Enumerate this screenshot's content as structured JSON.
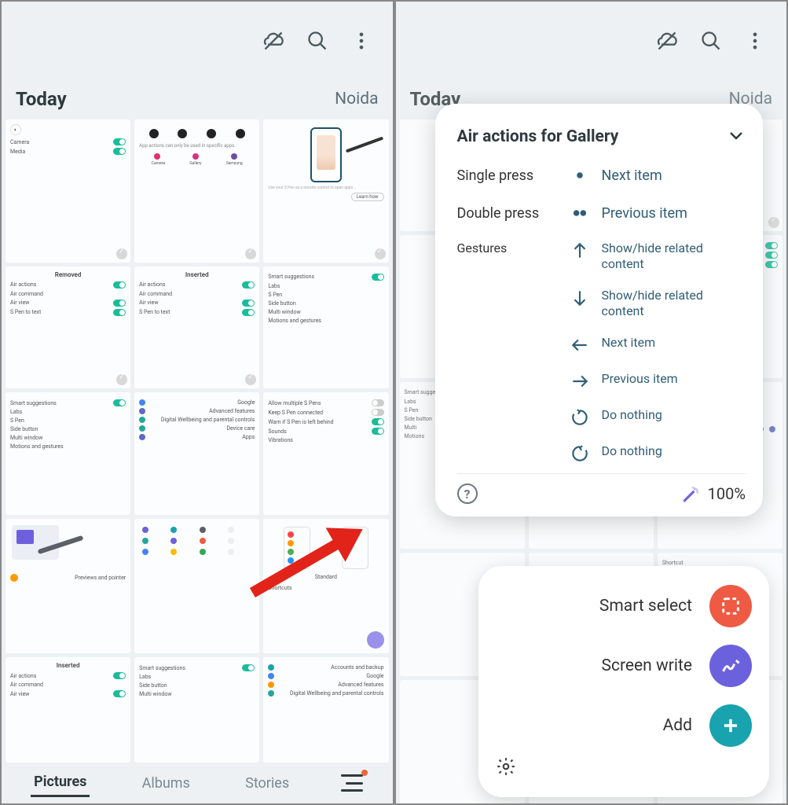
{
  "header_icons": [
    "cloud-off",
    "search",
    "more"
  ],
  "section": {
    "left": "Today",
    "right": "Noida"
  },
  "tabs": {
    "pictures": "Pictures",
    "albums": "Albums",
    "stories": "Stories"
  },
  "thumbs": {
    "r1c1": {
      "lines": [
        "Camera",
        "Media"
      ]
    },
    "r1c2": {
      "apps": [
        "Camera",
        "Gallery",
        "Samsung"
      ]
    },
    "r1c3": {
      "btn": "Learn how"
    },
    "r2c1": {
      "title": "Removed",
      "lines": [
        "Air actions",
        "Air command",
        "Air view",
        "S Pen to text"
      ]
    },
    "r2c2": {
      "title": "Inserted",
      "lines": [
        "Air actions",
        "Air command",
        "Air view",
        "S Pen to text"
      ]
    },
    "r2c3": {
      "lines": [
        "Smart suggestions",
        "Labs",
        "S Pen",
        "Side button",
        "Multi window",
        "Motions and gestures"
      ]
    },
    "r3c1": {
      "lines": [
        "Smart suggestions",
        "Labs",
        "S Pen",
        "Side button",
        "Multi window",
        "Motions and gestures"
      ]
    },
    "r3c2": {
      "lines": [
        "Google",
        "Advanced features",
        "Digital Wellbeing and parental controls",
        "Device care",
        "Apps"
      ]
    },
    "r3c3": {
      "lines": [
        "Allow multiple S Pens",
        "Keep S Pen connected",
        "Warn if S Pen is left behind",
        "Sounds",
        "Vibrations"
      ]
    },
    "r4c1": {
      "caption": "Previews and pointer"
    },
    "r4c2": {
      "icons": true
    },
    "r4c3": {
      "lines": [
        "Standard",
        "Shortcuts"
      ]
    },
    "r5c1": {
      "title": "Inserted",
      "lines": [
        "Air actions",
        "Air command",
        "Air view"
      ]
    },
    "r5c2": {
      "lines": [
        "Smart suggestions",
        "Labs",
        "Side button",
        "Multi window"
      ]
    },
    "r5c3": {
      "lines": [
        "Accounts and backup",
        "Google",
        "Advanced features",
        "Digital Wellbeing and parental controls"
      ]
    }
  },
  "popup": {
    "title": "Air actions for Gallery",
    "single": {
      "label": "Single press",
      "value": "Next item"
    },
    "double": {
      "label": "Double press",
      "value": "Previous item"
    },
    "gestures_label": "Gestures",
    "gestures": [
      {
        "dir": "up",
        "value": "Show/hide related content"
      },
      {
        "dir": "down",
        "value": "Show/hide related content"
      },
      {
        "dir": "left",
        "value": "Next item"
      },
      {
        "dir": "right",
        "value": "Previous item"
      },
      {
        "dir": "cw",
        "value": "Do nothing"
      },
      {
        "dir": "ccw",
        "value": "Do nothing"
      }
    ],
    "battery": "100%"
  },
  "aircmd": {
    "smart": "Smart select",
    "write": "Screen write",
    "add": "Add"
  }
}
